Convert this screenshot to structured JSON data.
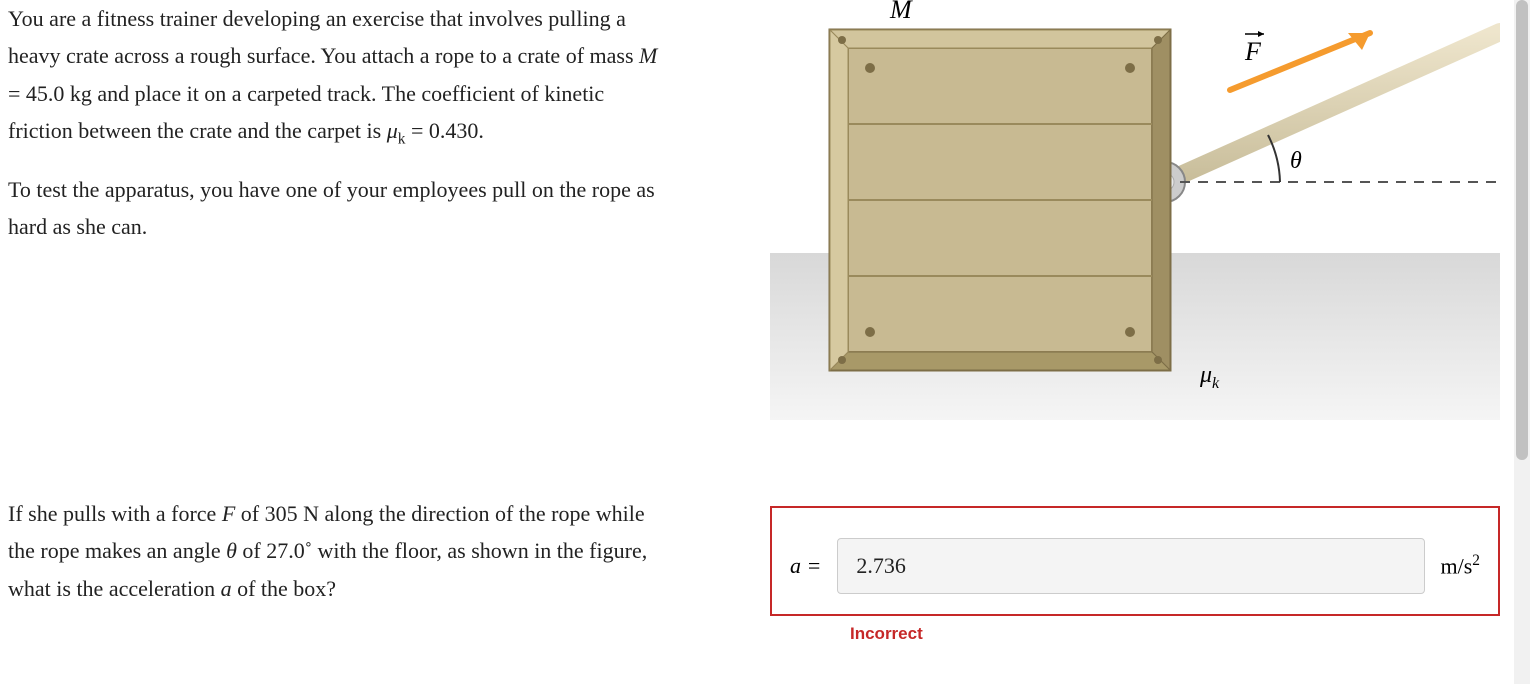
{
  "problem": {
    "para1_a": "You are a fitness trainer developing an exercise that involves pulling a heavy crate across a rough surface. You attach a rope to a crate of mass ",
    "mass_sym": "M",
    "para1_b": " = 45.0 kg and place it on a carpeted track. The coefficient of kinetic friction between the crate and the carpet is ",
    "mu_sym": "μ",
    "mu_sub": "k",
    "para1_c": " = 0.430.",
    "para2": "To test the apparatus, you have one of your employees pull on the rope as hard as she can."
  },
  "question": {
    "part_a": "If she pulls with a force ",
    "F_sym": "F",
    "part_b": " of 305 N along the direction of the rope while the rope makes an angle ",
    "theta_sym": "θ",
    "part_c": " of 27.0˚ with the floor, as shown in the figure, what is the acceleration ",
    "a_sym": "a",
    "part_d": " of the box?"
  },
  "figure": {
    "M_label": "M",
    "F_label": "F",
    "theta_label": "θ",
    "mu_label": "μ",
    "mu_sub": "k"
  },
  "answer": {
    "label": "a =",
    "value": "2.736",
    "units_base": "m/s",
    "units_sup": "2",
    "feedback": "Incorrect"
  }
}
